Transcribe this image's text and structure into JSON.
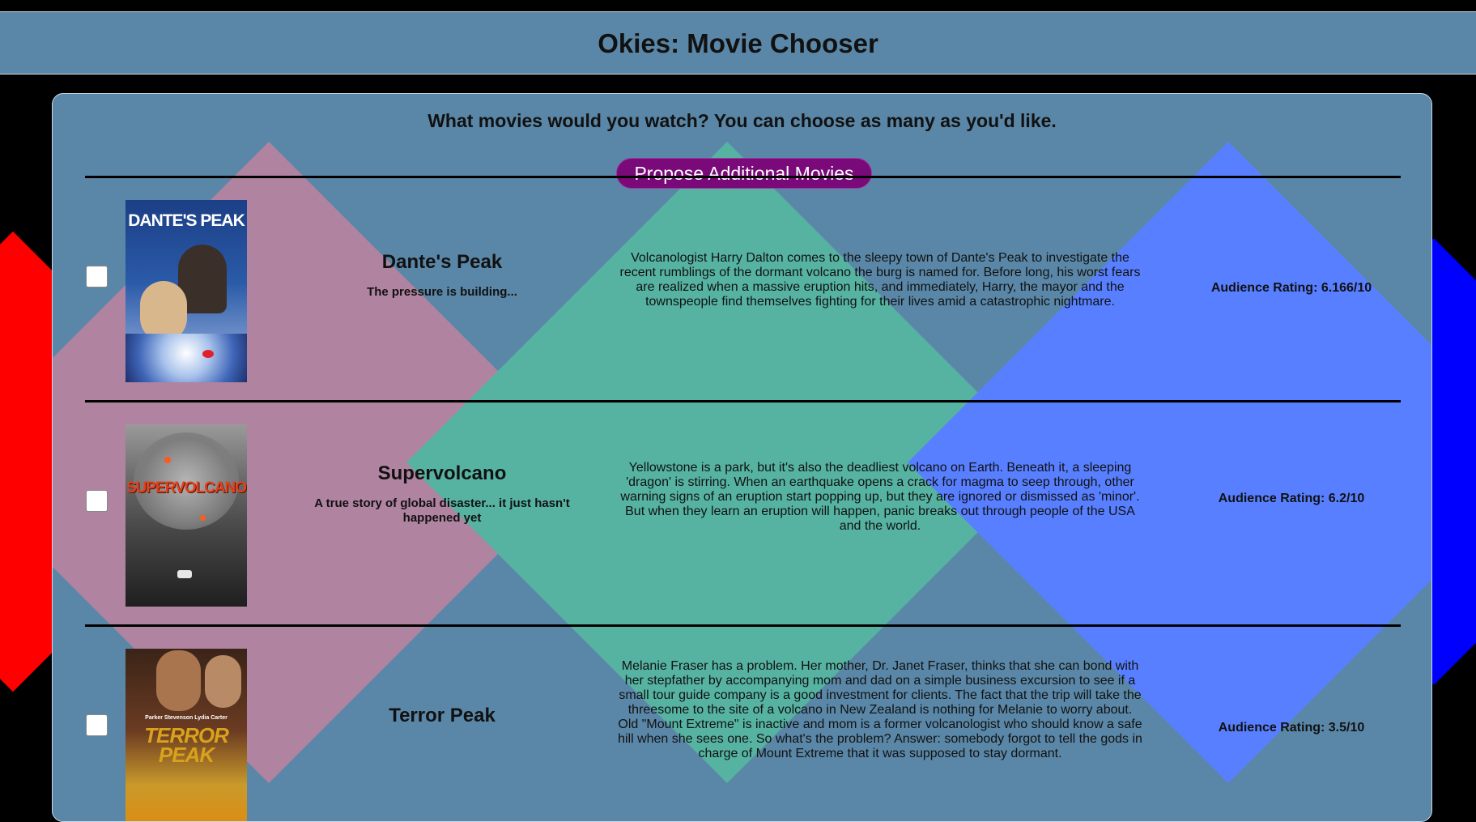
{
  "header": {
    "title": "Okies: Movie Chooser"
  },
  "panel": {
    "question": "What movies would you watch? You can choose as many as you'd like.",
    "propose_button_label": "Propose Additional Movies"
  },
  "movies": [
    {
      "poster_text": "DANTE'S PEAK",
      "title": "Dante's Peak",
      "tagline": "The pressure is building...",
      "synopsis": "Volcanologist Harry Dalton comes to the sleepy town of Dante's Peak to investigate the recent rumblings of the dormant volcano the burg is named for. Before long, his worst fears are realized when a massive eruption hits, and immediately, Harry, the mayor and the townspeople find themselves fighting for their lives amid a catastrophic nightmare.",
      "rating": "Audience Rating: 6.166/10",
      "selected": false
    },
    {
      "poster_text": "SUPERVOLCANO",
      "title": "Supervolcano",
      "tagline": "A true story of global disaster... it just hasn't happened yet",
      "synopsis": "Yellowstone is a park, but it's also the deadliest volcano on Earth. Beneath it, a sleeping 'dragon' is stirring. When an earthquake opens a crack for magma to seep through, other warning signs of an eruption start popping up, but they are ignored or dismissed as 'minor'. But when they learn an eruption will happen, panic breaks out through people of the USA and the world.",
      "rating": "Audience Rating: 6.2/10",
      "selected": false
    },
    {
      "poster_text": "TERROR PEAK",
      "poster_credits": "Parker Stevenson    Lydia Carter",
      "title": "Terror Peak",
      "tagline": "",
      "synopsis": "Melanie Fraser has a problem. Her mother, Dr. Janet Fraser, thinks that she can bond with her stepfather by accompanying mom and dad on a simple business excursion to see if a small tour guide company is a good investment for clients. The fact that the trip will take the threesome to the site of a volcano in New Zealand is nothing for Melanie to worry about. Old \"Mount Extreme\" is inactive and mom is a former volcanologist who should know a safe hill when she sees one. So what's the problem? Answer: somebody forgot to tell the gods in charge of Mount Extreme that it was supposed to stay dormant.",
      "rating": "Audience Rating: 3.5/10",
      "selected": false
    }
  ],
  "colors": {
    "background": "#000000",
    "header_bg": "#5a87a7",
    "panel_bg": "#5a87a7",
    "button_bg": "#7a0a7a",
    "diamond_pink": "#b083a0",
    "diamond_green": "#56b3a2",
    "diamond_blue": "#587fff",
    "diamond_red": "#ff0000",
    "diamond_dark_blue": "#0000ff"
  }
}
